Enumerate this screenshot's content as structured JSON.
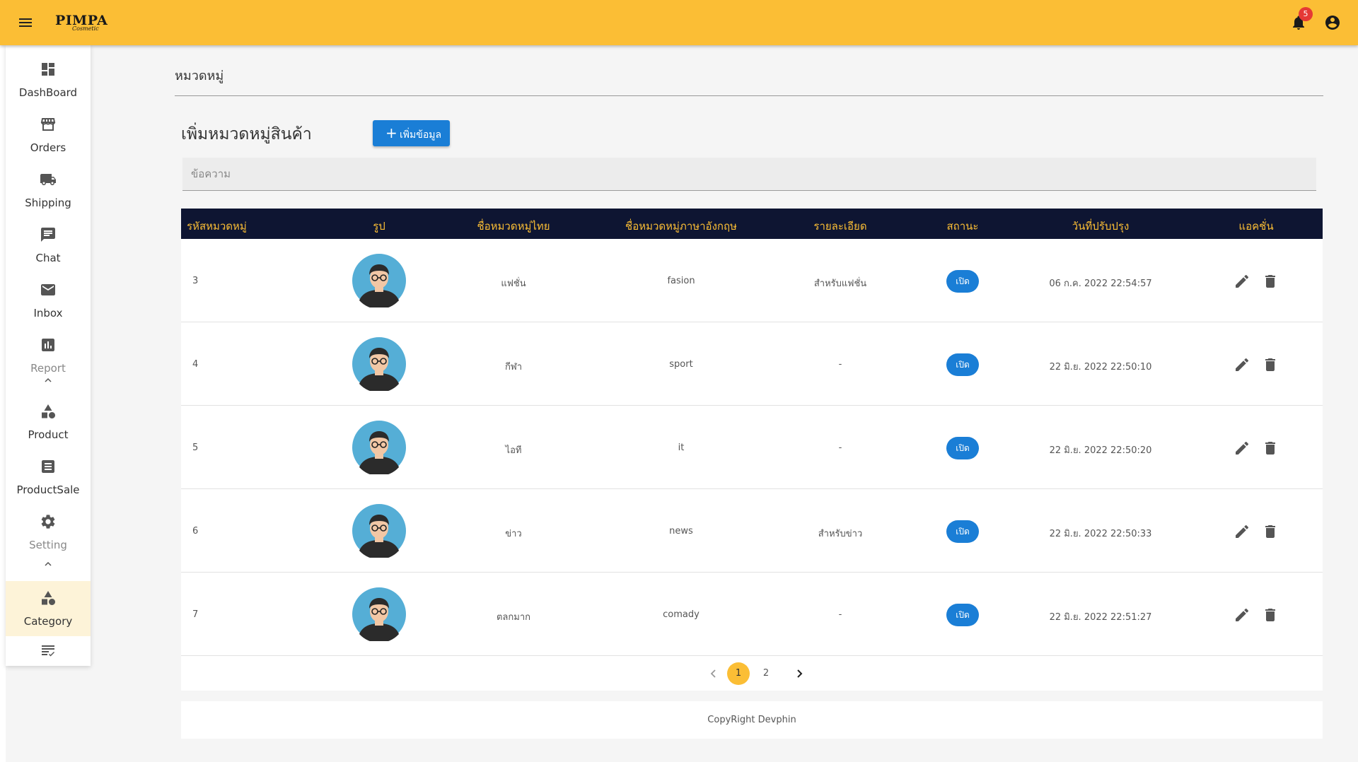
{
  "app": {
    "logo_text": "PIMPA",
    "logo_subtext": "Cosmetic",
    "notification_count": "5",
    "accent_color": "#fbbe35",
    "primary_color": "#1a7ed6",
    "header_dark_color": "#0e1532"
  },
  "sidebar": {
    "items": [
      {
        "label": "DashBoard",
        "icon": "dashboard-icon"
      },
      {
        "label": "Orders",
        "icon": "storefront-icon"
      },
      {
        "label": "Shipping",
        "icon": "truck-icon"
      },
      {
        "label": "Chat",
        "icon": "chat-icon"
      },
      {
        "label": "Inbox",
        "icon": "mail-icon"
      },
      {
        "label": "Report",
        "icon": "bar-chart-icon"
      },
      {
        "label": "Product",
        "icon": "shapes-icon"
      },
      {
        "label": "ProductSale",
        "icon": "list-icon"
      },
      {
        "label": "Setting",
        "icon": "gear-icon"
      },
      {
        "label": "Category",
        "icon": "shapes-icon",
        "active": true
      }
    ]
  },
  "main": {
    "title": "หมวดหมู่",
    "section_heading": "เพิ่มหมวดหมู่สินค้า",
    "add_button_label": "เพิ่มข้อมูล",
    "search_placeholder": "ข้อความ"
  },
  "table": {
    "columns": [
      "รหัสหมวดหมู่",
      "รูป",
      "ชื่อหมวดหมู่ไทย",
      "ชื่อหมวดหมู่ภาษาอังกฤษ",
      "รายละเอียด",
      "สถานะ",
      "วันที่ปรับปรุง",
      "แอคชั่น"
    ],
    "rows": [
      {
        "id": "3",
        "name_th": "แฟชั่น",
        "name_en": "fasion",
        "detail": "สำหรับแฟชั่น",
        "status": "เปิด",
        "updated": "06 ก.ค. 2022 22:54:57"
      },
      {
        "id": "4",
        "name_th": "กีฬา",
        "name_en": "sport",
        "detail": "-",
        "status": "เปิด",
        "updated": "22 มิ.ย. 2022 22:50:10"
      },
      {
        "id": "5",
        "name_th": "ไอที",
        "name_en": "it",
        "detail": "-",
        "status": "เปิด",
        "updated": "22 มิ.ย. 2022 22:50:20"
      },
      {
        "id": "6",
        "name_th": "ข่าว",
        "name_en": "news",
        "detail": "สำหรับข่าว",
        "status": "เปิด",
        "updated": "22 มิ.ย. 2022 22:50:33"
      },
      {
        "id": "7",
        "name_th": "ตลกมาก",
        "name_en": "comady",
        "detail": "-",
        "status": "เปิด",
        "updated": "22 มิ.ย. 2022 22:51:27"
      }
    ]
  },
  "pagination": {
    "pages": [
      "1",
      "2"
    ],
    "current": "1"
  },
  "footer": {
    "text": "CopyRight Devphin"
  }
}
